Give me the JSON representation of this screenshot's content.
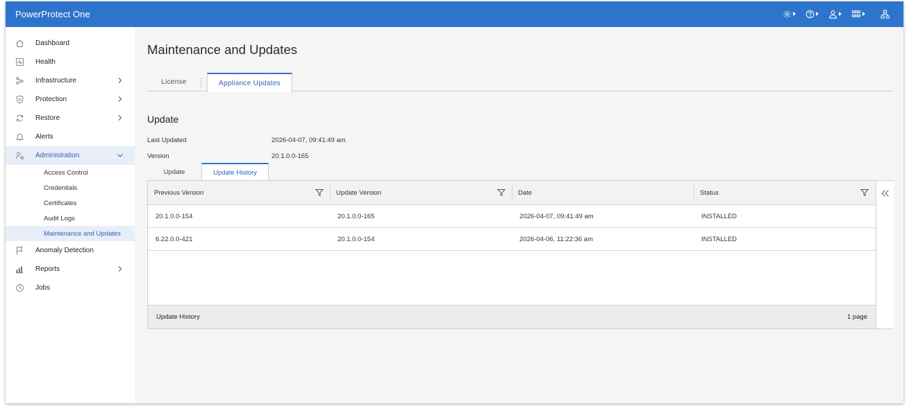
{
  "app": {
    "title": "PowerProtect One"
  },
  "topbar": {
    "icons": [
      "gear-icon",
      "help-icon",
      "user-icon",
      "apps-grid-icon",
      "network-icon"
    ]
  },
  "sidebar": {
    "items": [
      {
        "label": "Dashboard",
        "icon": "home-icon",
        "has_children": false
      },
      {
        "label": "Health",
        "icon": "health-icon",
        "has_children": false
      },
      {
        "label": "Infrastructure",
        "icon": "infrastructure-icon",
        "has_children": true
      },
      {
        "label": "Protection",
        "icon": "shield-icon",
        "has_children": true
      },
      {
        "label": "Restore",
        "icon": "restore-icon",
        "has_children": true
      },
      {
        "label": "Alerts",
        "icon": "bell-icon",
        "has_children": false
      },
      {
        "label": "Administration",
        "icon": "admin-user-icon",
        "has_children": true,
        "expanded": true
      },
      {
        "label": "Anomaly Detection",
        "icon": "flag-icon",
        "has_children": false
      },
      {
        "label": "Reports",
        "icon": "bar-chart-icon",
        "has_children": true
      },
      {
        "label": "Jobs",
        "icon": "clock-icon",
        "has_children": false
      }
    ],
    "admin_subitems": [
      {
        "label": "Access Control"
      },
      {
        "label": "Credentials"
      },
      {
        "label": "Certificates"
      },
      {
        "label": "Audit Logs"
      },
      {
        "label": "Maintenance and Updates"
      }
    ]
  },
  "main": {
    "title": "Maintenance and Updates",
    "tabs": [
      {
        "label": "License"
      },
      {
        "label": "Appliance Updates"
      }
    ],
    "section_title": "Update",
    "last_updated_label": "Last Updated",
    "last_updated_value": "2026-04-07, 09:41:49 am",
    "version_label": "Version",
    "version_value": "20.1.0.0-165",
    "subtabs": [
      {
        "label": "Update"
      },
      {
        "label": "Update History"
      }
    ],
    "table": {
      "columns": [
        "Previous Version",
        "Update Version",
        "Date",
        "Status"
      ],
      "rows": [
        [
          "20.1.0.0-154",
          "20.1.0.0-165",
          "2026-04-07, 09:41:49 am",
          "INSTALLED"
        ],
        [
          "6.22.0.0-421",
          "20.1.0.0-154",
          "2026-04-06, 11:22:36 am",
          "INSTALLED"
        ]
      ],
      "footer_label": "Update History",
      "footer_pages": "1 page"
    }
  },
  "colors": {
    "topbar": "#2f74cc",
    "accent": "#2a64b8",
    "active_bg": "#e8eef8"
  }
}
